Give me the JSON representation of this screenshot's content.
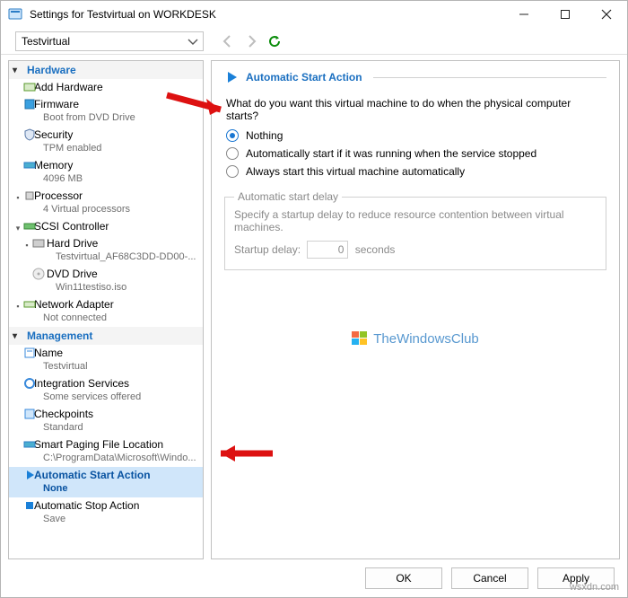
{
  "window": {
    "title": "Settings for Testvirtual on WORKDESK"
  },
  "vm_selector": {
    "value": "Testvirtual"
  },
  "sidebar": {
    "sections": {
      "hardware": {
        "label": "Hardware"
      },
      "management": {
        "label": "Management"
      }
    },
    "hardware_items": [
      {
        "label": "Add Hardware",
        "sub": ""
      },
      {
        "label": "Firmware",
        "sub": "Boot from DVD Drive"
      },
      {
        "label": "Security",
        "sub": "TPM enabled"
      },
      {
        "label": "Memory",
        "sub": "4096 MB"
      },
      {
        "label": "Processor",
        "sub": "4 Virtual processors"
      },
      {
        "label": "SCSI Controller",
        "sub": ""
      },
      {
        "label": "Hard Drive",
        "sub": "Testvirtual_AF68C3DD-DD00-..."
      },
      {
        "label": "DVD Drive",
        "sub": "Win11testiso.iso"
      },
      {
        "label": "Network Adapter",
        "sub": "Not connected"
      }
    ],
    "management_items": [
      {
        "label": "Name",
        "sub": "Testvirtual"
      },
      {
        "label": "Integration Services",
        "sub": "Some services offered"
      },
      {
        "label": "Checkpoints",
        "sub": "Standard"
      },
      {
        "label": "Smart Paging File Location",
        "sub": "C:\\ProgramData\\Microsoft\\Windo..."
      },
      {
        "label": "Automatic Start Action",
        "sub": "None"
      },
      {
        "label": "Automatic Stop Action",
        "sub": "Save"
      }
    ]
  },
  "content": {
    "header": "Automatic Start Action",
    "question": "What do you want this virtual machine to do when the physical computer starts?",
    "options": [
      "Nothing",
      "Automatically start if it was running when the service stopped",
      "Always start this virtual machine automatically"
    ],
    "delay": {
      "legend": "Automatic start delay",
      "text": "Specify a startup delay to reduce resource contention between virtual machines.",
      "label": "Startup delay:",
      "value": "0",
      "unit": "seconds"
    }
  },
  "watermark": "TheWindowsClub",
  "footer": {
    "ok": "OK",
    "cancel": "Cancel",
    "apply": "Apply"
  },
  "site_mark": "wsxdn.com"
}
